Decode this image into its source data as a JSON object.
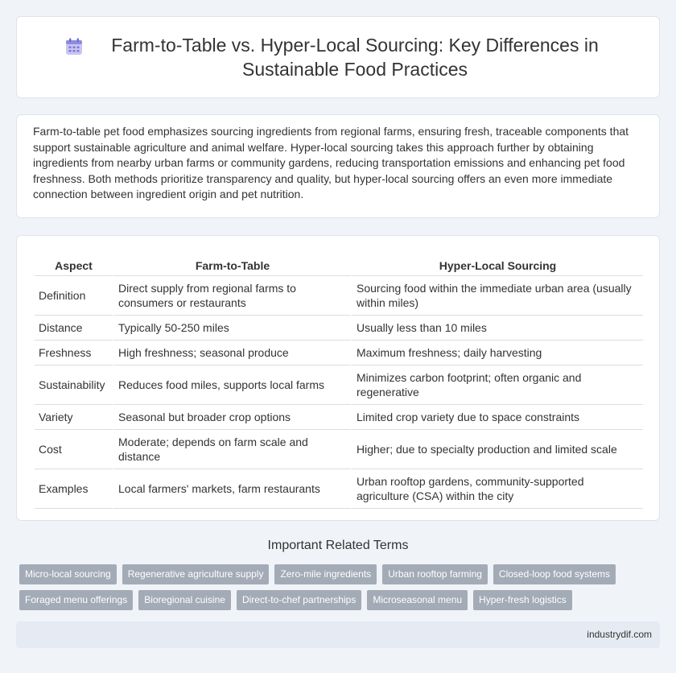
{
  "title": {
    "text": "Farm-to-Table vs. Hyper-Local Sourcing: Key Differences in Sustainable Food Practices",
    "icon": "calendar-icon"
  },
  "intro": "Farm-to-table pet food emphasizes sourcing ingredients from regional farms, ensuring fresh, traceable components that support sustainable agriculture and animal welfare. Hyper-local sourcing takes this approach further by obtaining ingredients from nearby urban farms or community gardens, reducing transportation emissions and enhancing pet food freshness. Both methods prioritize transparency and quality, but hyper-local sourcing offers an even more immediate connection between ingredient origin and pet nutrition.",
  "table": {
    "headers": [
      "Aspect",
      "Farm-to-Table",
      "Hyper-Local Sourcing"
    ],
    "rows": [
      [
        "Definition",
        "Direct supply from regional farms to consumers or restaurants",
        "Sourcing food within the immediate urban area (usually within miles)"
      ],
      [
        "Distance",
        "Typically 50-250 miles",
        "Usually less than 10 miles"
      ],
      [
        "Freshness",
        "High freshness; seasonal produce",
        "Maximum freshness; daily harvesting"
      ],
      [
        "Sustainability",
        "Reduces food miles, supports local farms",
        "Minimizes carbon footprint; often organic and regenerative"
      ],
      [
        "Variety",
        "Seasonal but broader crop options",
        "Limited crop variety due to space constraints"
      ],
      [
        "Cost",
        "Moderate; depends on farm scale and distance",
        "Higher; due to specialty production and limited scale"
      ],
      [
        "Examples",
        "Local farmers' markets, farm restaurants",
        "Urban rooftop gardens, community-supported agriculture (CSA) within the city"
      ]
    ]
  },
  "related": {
    "heading": "Important Related Terms",
    "terms": [
      "Micro-local sourcing",
      "Regenerative agriculture supply",
      "Zero-mile ingredients",
      "Urban rooftop farming",
      "Closed-loop food systems",
      "Foraged menu offerings",
      "Bioregional cuisine",
      "Direct-to-chef partnerships",
      "Microseasonal menu",
      "Hyper-fresh logistics"
    ]
  },
  "footer": "industrydif.com",
  "colors": {
    "background": "#f0f3f8",
    "tag": "#a3abb6",
    "footer": "#e5eaf3",
    "icon": "#8e8ce0"
  }
}
